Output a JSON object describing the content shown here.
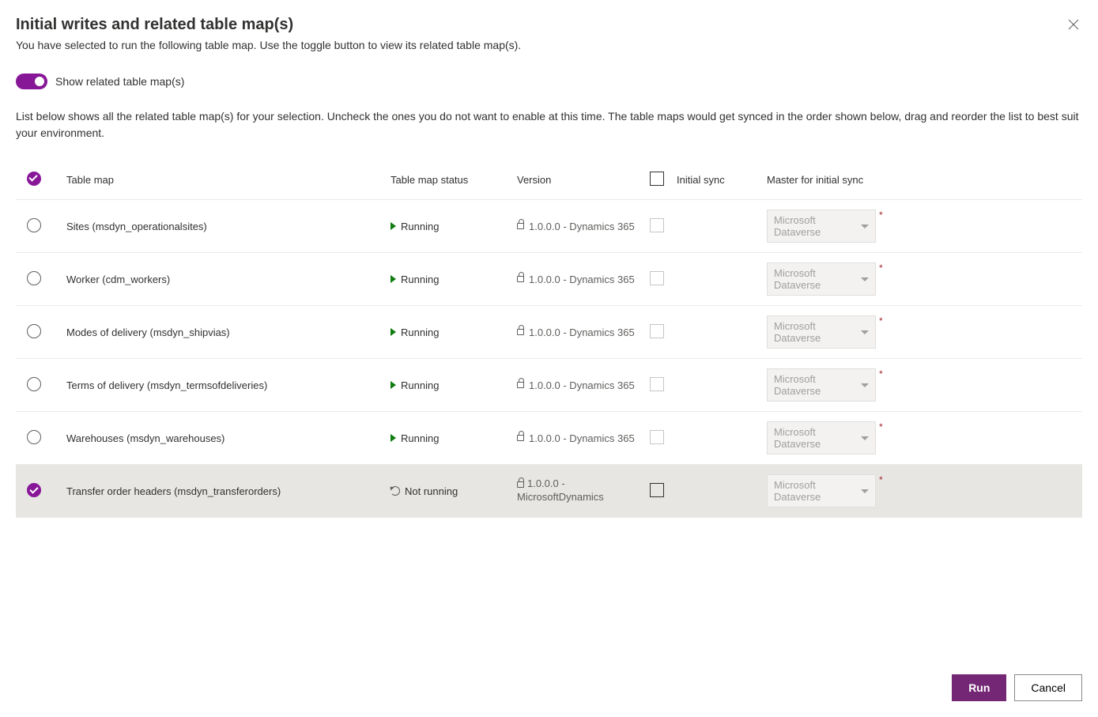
{
  "header": {
    "title": "Initial writes and related table map(s)",
    "subtitle": "You have selected to run the following table map. Use the toggle button to view its related table map(s)."
  },
  "toggle": {
    "label": "Show related table map(s)",
    "on": true
  },
  "description": "List below shows all the related table map(s) for your selection. Uncheck the ones you do not want to enable at this time. The table maps would get synced in the order shown below, drag and reorder the list to best suit your environment.",
  "table": {
    "columns": {
      "map": "Table map",
      "status": "Table map status",
      "version": "Version",
      "initial_sync": "Initial sync",
      "master": "Master for initial sync"
    },
    "rows": [
      {
        "selected": false,
        "map": "Sites (msdyn_operationalsites)",
        "status": "Running",
        "running": true,
        "version": "1.0.0.0 - Dynamics 365",
        "master": "Microsoft Dataverse"
      },
      {
        "selected": false,
        "map": "Worker (cdm_workers)",
        "status": "Running",
        "running": true,
        "version": "1.0.0.0 - Dynamics 365",
        "master": "Microsoft Dataverse"
      },
      {
        "selected": false,
        "map": "Modes of delivery (msdyn_shipvias)",
        "status": "Running",
        "running": true,
        "version": "1.0.0.0 - Dynamics 365",
        "master": "Microsoft Dataverse"
      },
      {
        "selected": false,
        "map": "Terms of delivery (msdyn_termsofdeliveries)",
        "status": "Running",
        "running": true,
        "version": "1.0.0.0 - Dynamics 365",
        "master": "Microsoft Dataverse"
      },
      {
        "selected": false,
        "map": "Warehouses (msdyn_warehouses)",
        "status": "Running",
        "running": true,
        "version": "1.0.0.0 - Dynamics 365",
        "master": "Microsoft Dataverse"
      },
      {
        "selected": true,
        "map": "Transfer order headers (msdyn_transferorders)",
        "status": "Not running",
        "running": false,
        "version": "1.0.0.0 - MicrosoftDynamics",
        "master": "Microsoft Dataverse"
      }
    ]
  },
  "footer": {
    "run": "Run",
    "cancel": "Cancel"
  }
}
